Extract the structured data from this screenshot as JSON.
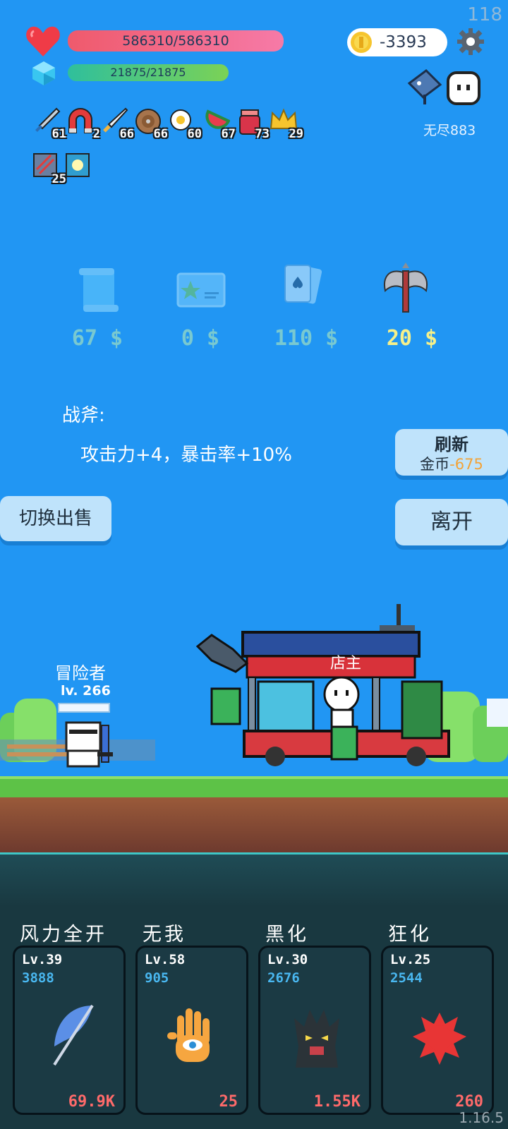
{
  "hud": {
    "fps": "118",
    "hp": "586310/586310",
    "mp": "21875/21875",
    "coins": "-3393",
    "endless_label": "无尽883",
    "version": "1.16.5"
  },
  "items_row1": [
    {
      "icon": "sword-icon",
      "count": "61"
    },
    {
      "icon": "magnet-icon",
      "count": "2"
    },
    {
      "icon": "dagger-icon",
      "count": "66"
    },
    {
      "icon": "shield-icon",
      "count": "66"
    },
    {
      "icon": "egg-icon",
      "count": "60"
    },
    {
      "icon": "watermelon-icon",
      "count": "67"
    },
    {
      "icon": "jam-jar-icon",
      "count": "73"
    },
    {
      "icon": "crown-icon",
      "count": "29"
    }
  ],
  "items_row2": [
    {
      "icon": "scratched-card-icon",
      "count": "25"
    },
    {
      "icon": "glowing-tile-icon",
      "count": ""
    }
  ],
  "shop": {
    "items": [
      {
        "icon": "scroll-icon",
        "price": "67 $"
      },
      {
        "icon": "star-card-icon",
        "price": "0 $"
      },
      {
        "icon": "playing-cards-icon",
        "price": "110 $"
      },
      {
        "icon": "battle-axe-icon",
        "price": "20 $"
      }
    ],
    "selected_name": "战斧:",
    "selected_desc": "攻击力+4，暴击率+10%",
    "refresh_label": "刷新",
    "refresh_cost_prefix": "金币",
    "refresh_cost_value": "-675",
    "switch_label": "切换出售",
    "leave_label": "离开"
  },
  "scene": {
    "adventurer_label": "冒险者",
    "adventurer_level": "lv. 266",
    "shopkeeper_label": "店主"
  },
  "skills": [
    {
      "name": "风力全开",
      "level": "Lv.39",
      "power": "3888",
      "cost": "69.9K",
      "icon": "feather-icon"
    },
    {
      "name": "无我",
      "level": "Lv.58",
      "power": "905",
      "cost": "25",
      "icon": "eye-hand-icon"
    },
    {
      "name": "黑化",
      "level": "Lv.30",
      "power": "2676",
      "cost": "1.55K",
      "icon": "dark-tree-icon"
    },
    {
      "name": "狂化",
      "level": "Lv.25",
      "power": "2544",
      "cost": "260",
      "icon": "red-splat-icon"
    }
  ],
  "colors": {
    "sky": "#2196F3",
    "hp_bar": "#ef5a6c",
    "mp_bar": "#2fbf9c",
    "price_active": "#f5f08a",
    "skill_cost": "#ff6a6a"
  }
}
